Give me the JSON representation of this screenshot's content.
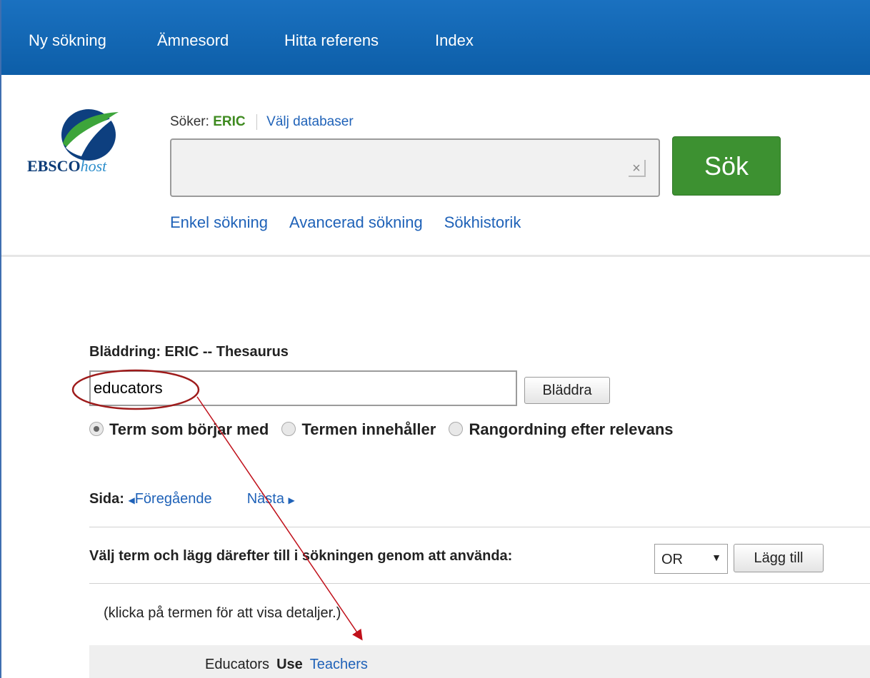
{
  "nav": {
    "items": [
      "Ny sökning",
      "Ämnesord",
      "Hitta referens",
      "Index"
    ]
  },
  "header": {
    "logo_text_bold": "EBSCO",
    "logo_text_italic": "host",
    "searching_label": "Söker:",
    "database": "ERIC",
    "choose_db_link": "Välj databaser",
    "search_value": "",
    "search_button": "Sök",
    "clear_glyph": "×",
    "links": [
      "Enkel sökning",
      "Avancerad sökning",
      "Sökhistorik"
    ]
  },
  "browse": {
    "title": "Bläddring: ERIC -- Thesaurus",
    "input_value": "educators",
    "button": "Bläddra",
    "radios": [
      {
        "label": "Term som börjar med",
        "checked": true
      },
      {
        "label": "Termen innehåller",
        "checked": false
      },
      {
        "label": "Rangordning efter relevans",
        "checked": false
      }
    ],
    "page_label": "Sida:",
    "prev": "Föregående",
    "next": "Nästa",
    "choose_text": "Välj term och lägg därefter till i sökningen genom att använda:",
    "operator": "OR",
    "add_button": "Lägg till",
    "hint": "(klicka på termen för att visa detaljer.)",
    "term": "Educators",
    "use_label": "Use",
    "use_term": "Teachers"
  },
  "colors": {
    "nav_bg": "#1a71c0",
    "link": "#1f62b8",
    "search_button": "#3d9131",
    "db_name": "#3e8a1f",
    "annotation": "#c0101a"
  }
}
